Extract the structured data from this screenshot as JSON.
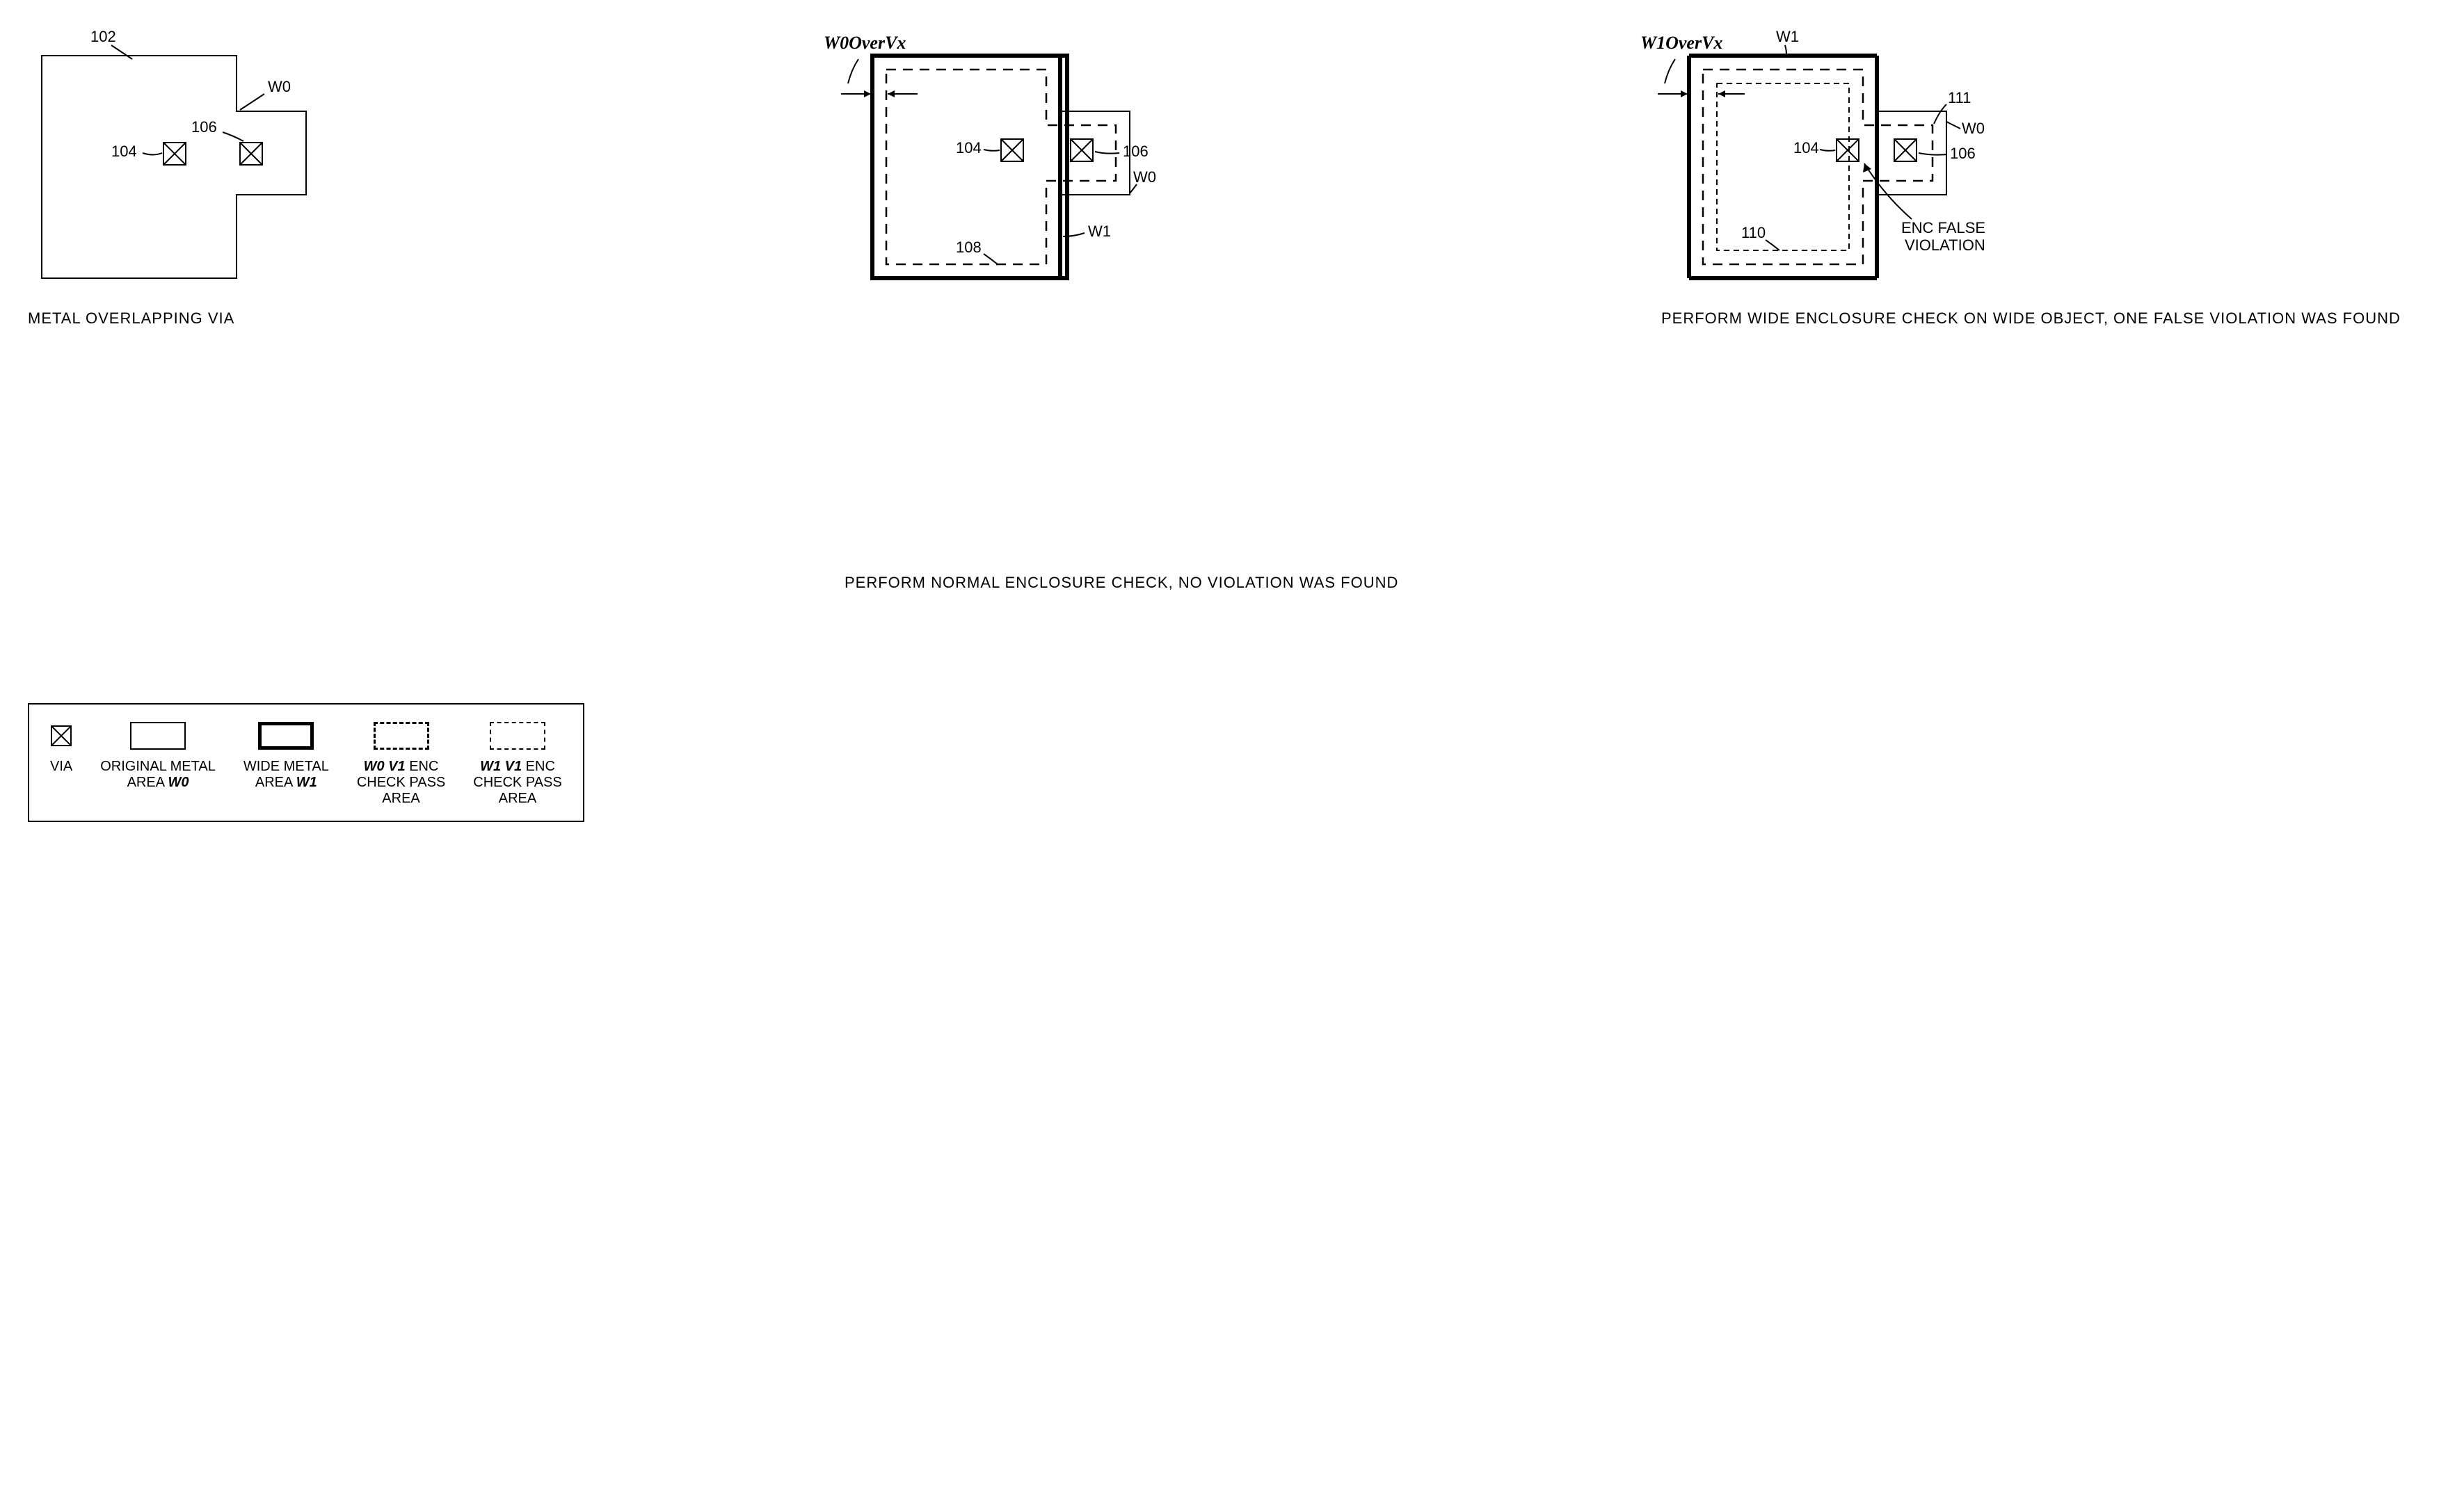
{
  "panels": [
    {
      "caption": "METAL OVERLAPPING VIA",
      "refs": {
        "shape": "102",
        "via1": "104",
        "via2": "106",
        "region": "W0"
      }
    },
    {
      "caption": "PERFORM NORMAL ENCLOSURE CHECK, NO VIOLATION WAS FOUND",
      "dim_label": "W0OverVx",
      "refs": {
        "via1": "104",
        "via2": "106",
        "dash": "108",
        "thin": "W0",
        "thick": "W1"
      }
    },
    {
      "caption": "PERFORM WIDE ENCLOSURE CHECK ON WIDE OBJECT, ONE FALSE VIOLATION WAS FOUND",
      "dim_label": "W1OverVx",
      "refs": {
        "via1": "104",
        "via2": "106",
        "dash": "110",
        "thin": "W0",
        "thick": "W1",
        "false_ref": "111",
        "false_label": "ENC FALSE VIOLATION"
      }
    }
  ],
  "legend": {
    "via": "VIA",
    "original": {
      "l1": "ORIGINAL METAL",
      "l2": "AREA",
      "em": "W0"
    },
    "wide": {
      "l1": "WIDE METAL",
      "l2": "AREA",
      "em": "W1"
    },
    "w0v1": {
      "em": "W0 V1",
      "rest1": "ENC",
      "rest2": "CHECK PASS",
      "rest3": "AREA"
    },
    "w1v1": {
      "em": "W1 V1",
      "rest1": "ENC",
      "rest2": "CHECK PASS",
      "rest3": "AREA"
    }
  }
}
